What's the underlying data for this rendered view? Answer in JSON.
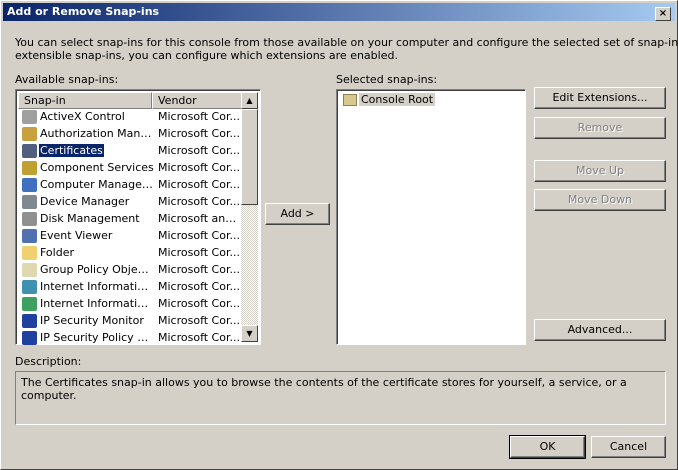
{
  "title": "Add or Remove Snap-ins",
  "close_label": "×",
  "intro_line1": "You can select snap-ins for this console from those available on your computer and configure the selected set of snap-ins. For",
  "intro_line2": "extensible snap-ins, you can configure which extensions are enabled.",
  "available_label": "Available snap-ins:",
  "selected_label": "Selected snap-ins:",
  "columns": [
    "Snap-in",
    "Vendor"
  ],
  "snapins": [
    {
      "name": "ActiveX Control",
      "vendor": "Microsoft Cor...",
      "icon": "activex-icon",
      "color": "#a0a0a0"
    },
    {
      "name": "Authorization Manager",
      "vendor": "Microsoft Cor...",
      "icon": "authorization-icon",
      "color": "#c8a040"
    },
    {
      "name": "Certificates",
      "vendor": "Microsoft Cor...",
      "icon": "certificates-icon",
      "color": "#506080",
      "selected": true
    },
    {
      "name": "Component Services",
      "vendor": "Microsoft Cor...",
      "icon": "component-services-icon",
      "color": "#c0a030"
    },
    {
      "name": "Computer Managem...",
      "vendor": "Microsoft Cor...",
      "icon": "computer-management-icon",
      "color": "#4070c0"
    },
    {
      "name": "Device Manager",
      "vendor": "Microsoft Cor...",
      "icon": "device-manager-icon",
      "color": "#808890"
    },
    {
      "name": "Disk Management",
      "vendor": "Microsoft and...",
      "icon": "disk-management-icon",
      "color": "#909090"
    },
    {
      "name": "Event Viewer",
      "vendor": "Microsoft Cor...",
      "icon": "event-viewer-icon",
      "color": "#5070b0"
    },
    {
      "name": "Folder",
      "vendor": "Microsoft Cor...",
      "icon": "folder-icon",
      "color": "#f0d070"
    },
    {
      "name": "Group Policy Object ...",
      "vendor": "Microsoft Cor...",
      "icon": "group-policy-icon",
      "color": "#e0d8b0"
    },
    {
      "name": "Internet Information...",
      "vendor": "Microsoft Cor...",
      "icon": "iis-icon",
      "color": "#4090b0"
    },
    {
      "name": "Internet Information...",
      "vendor": "Microsoft Cor...",
      "icon": "iis-icon",
      "color": "#40a060"
    },
    {
      "name": "IP Security Monitor",
      "vendor": "Microsoft Cor...",
      "icon": "ip-security-monitor-icon",
      "color": "#2040a0"
    },
    {
      "name": "IP Security Policy Ma...",
      "vendor": "Microsoft Cor...",
      "icon": "ip-security-policy-icon",
      "color": "#2040a0"
    }
  ],
  "selected_snapins": [
    "Console Root"
  ],
  "buttons": {
    "add": "Add >",
    "edit_extensions": "Edit Extensions...",
    "remove": "Remove",
    "move_up": "Move Up",
    "move_down": "Move Down",
    "advanced": "Advanced...",
    "ok": "OK",
    "cancel": "Cancel"
  },
  "description_label": "Description:",
  "description": "The Certificates snap-in allows you to browse the contents of the certificate stores for yourself, a service, or a computer."
}
